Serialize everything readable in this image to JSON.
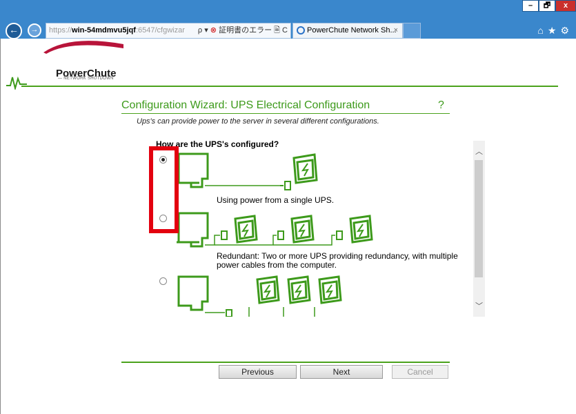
{
  "browser": {
    "address_prefix": "https://",
    "address_host": "win-54mdmvu5jqf",
    "address_rest": ":6547/cfgwizar",
    "address_controls": "ρ ▾",
    "cert_error": "証明書のエラー",
    "refresh_controls": "🗎 C",
    "tab_title": "PowerChute Network Sh...",
    "tab_close": "×",
    "window_minimize": "–",
    "window_restore": "🗗",
    "window_close": "x"
  },
  "logo": {
    "name": "PowerChute",
    "subtitle": "— NETWORK SHUTDOWN"
  },
  "wizard": {
    "title": "Configuration Wizard: UPS Electrical Configuration",
    "help": "?",
    "intro": "Ups's can provide power to the server in several different configurations.",
    "question": "How are the UPS's configured?",
    "options": [
      {
        "label": "Using power from a single UPS.",
        "selected": true
      },
      {
        "label": "Redundant: Two or more UPS providing redundancy, with multiple power cables from the computer.",
        "selected": false
      },
      {
        "label": "",
        "selected": false
      }
    ]
  },
  "buttons": {
    "previous": "Previous",
    "next": "Next",
    "cancel": "Cancel"
  },
  "colors": {
    "accent": "#3d9a1b",
    "highlight": "#e3000f",
    "chrome": "#3a87cc"
  }
}
